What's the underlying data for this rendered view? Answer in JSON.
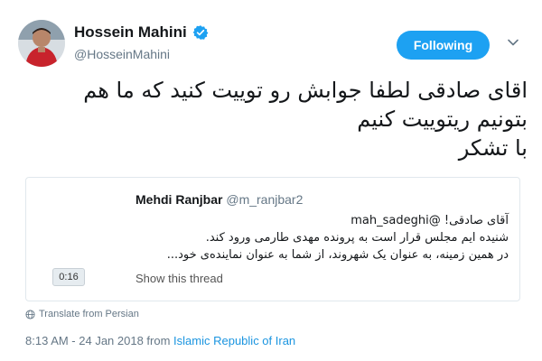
{
  "colors": {
    "accent": "#1da1f2",
    "link": "#1b95e0",
    "muted": "#657786",
    "text": "#14171a",
    "border": "#e1e8ed"
  },
  "author": {
    "name": "Hossein Mahini",
    "handle": "@HosseinMahini",
    "verified_icon": "verified-badge-icon"
  },
  "follow_button": {
    "label": "Following"
  },
  "tweet": {
    "lines": [
      "اقای صادقی لطفا جوابش رو توییت کنید که ما هم",
      "بتونیم ریتوییت کنیم",
      "با تشکر"
    ]
  },
  "quoted": {
    "name": "Mehdi Ranjbar",
    "handle": "@m_ranjbar2",
    "lines": [
      "آقای صادقی! @mah_sadeghi",
      "شنیده ایم مجلس قرار است به پرونده مهدی طارمی ورود کند.",
      "در همین زمینه، به عنوان یک شهروند، از شما به عنوان نماینده‌ی خود..."
    ],
    "video_duration": "0:16",
    "show_thread": "Show this thread"
  },
  "translate": {
    "label": "Translate from Persian",
    "icon": "globe-icon"
  },
  "meta": {
    "timestamp": "8:13 AM - 24 Jan 2018 from ",
    "location": "Islamic Republic of Iran"
  }
}
